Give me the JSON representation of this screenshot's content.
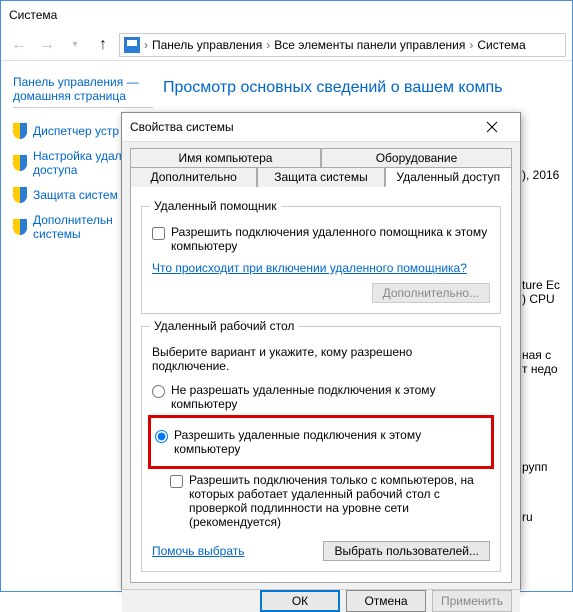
{
  "titlebar": "Система",
  "breadcrumb": {
    "items": [
      "Панель управления",
      "Все элементы панели управления",
      "Система"
    ]
  },
  "sidebar": {
    "home": "Панель управления — домашняя страница",
    "items": [
      {
        "label": "Диспетчер устр"
      },
      {
        "label": "Настройка удал\nдоступа"
      },
      {
        "label": "Защита систем"
      },
      {
        "label": "Дополнительн\nсистемы"
      }
    ]
  },
  "page_title": "Просмотр основных сведений о вашем компь",
  "right_fragments": {
    "a": "), 2016",
    "b": "ture Ec",
    "c": ") CPU",
    "d": "ная с",
    "e": "т недо",
    "f": "рупп",
    "g": "ru"
  },
  "dialog": {
    "title": "Свойства системы",
    "tabs": {
      "computer_name": "Имя компьютера",
      "hardware": "Оборудование",
      "advanced": "Дополнительно",
      "protection": "Защита системы",
      "remote": "Удаленный доступ"
    },
    "remote_assist": {
      "legend": "Удаленный помощник",
      "checkbox": "Разрешить подключения удаленного помощника к этому компьютеру",
      "link": "Что происходит при включении удаленного помощника?",
      "advanced_btn": "Дополнительно..."
    },
    "remote_desktop": {
      "legend": "Удаленный рабочий стол",
      "intro": "Выберите вариант и укажите, кому разрешено подключение.",
      "opt_disallow": "Не разрешать удаленные подключения к этому компьютеру",
      "opt_allow": "Разрешить удаленные подключения к этому компьютеру",
      "nla_checkbox": "Разрешить подключения только с компьютеров, на которых работает удаленный рабочий стол с проверкой подлинности на уровне сети (рекомендуется)",
      "help_link": "Помочь выбрать",
      "select_users_btn": "Выбрать пользователей..."
    },
    "buttons": {
      "ok": "ОК",
      "cancel": "Отмена",
      "apply": "Применить"
    }
  }
}
